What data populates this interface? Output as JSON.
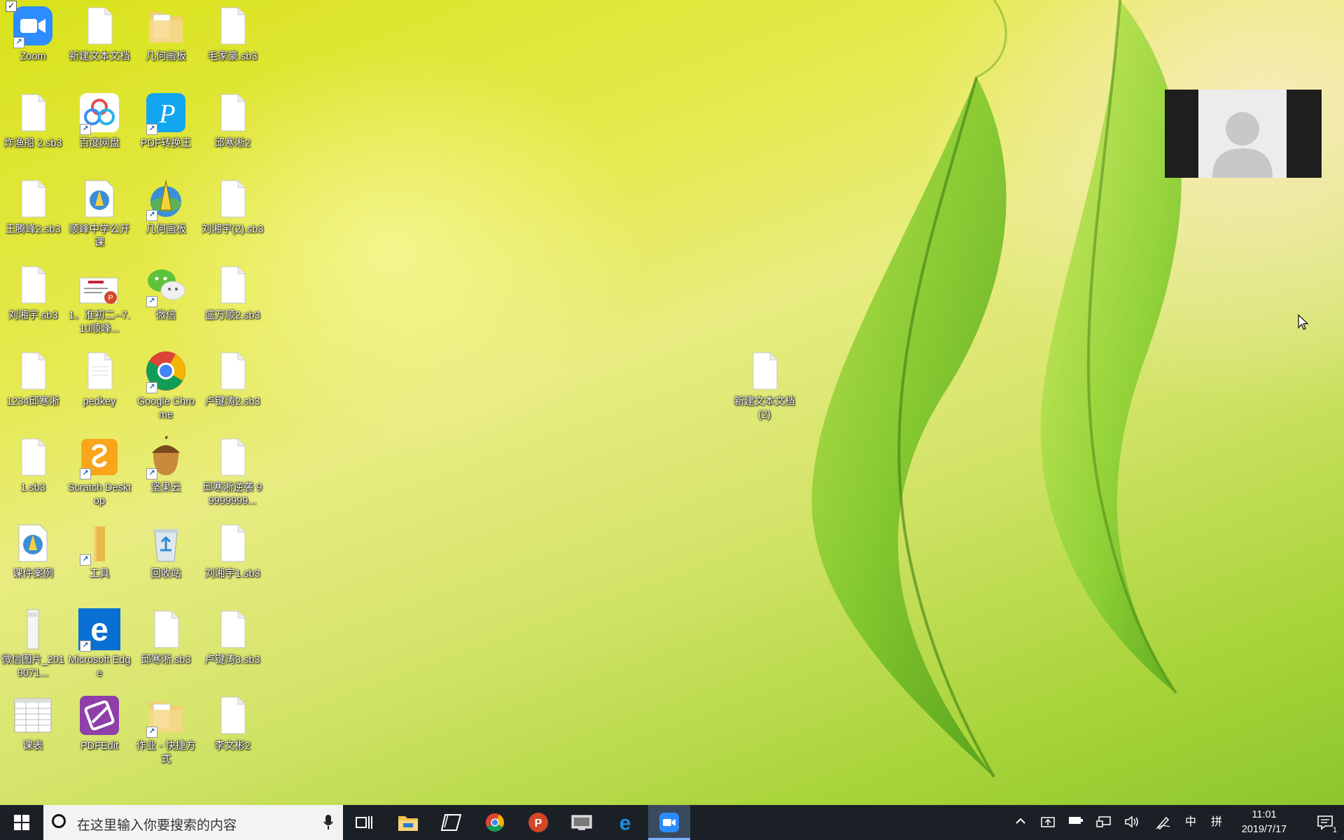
{
  "desktop": {
    "icons": [
      {
        "label": "Zoom",
        "icon": "zoom-icon"
      },
      {
        "label": "新建文本文档",
        "icon": "text-file-icon"
      },
      {
        "label": "几何画板",
        "icon": "folder-icon"
      },
      {
        "label": "毛家豪.sb3",
        "icon": "blank-file-icon"
      },
      {
        "label": "炸渔船 2.sb3",
        "icon": "blank-file-icon"
      },
      {
        "label": "百度网盘",
        "icon": "baidu-netdisk-icon"
      },
      {
        "label": "PDF转换王",
        "icon": "pdf-converter-icon"
      },
      {
        "label": "邱寒淅2",
        "icon": "blank-file-icon"
      },
      {
        "label": "王腾峰2.sb3",
        "icon": "blank-file-icon"
      },
      {
        "label": "顺峰中学公开课",
        "icon": "geometry-file-icon"
      },
      {
        "label": "几何画板",
        "icon": "geometry-sketchpad-icon"
      },
      {
        "label": "刘湘宇(2).sb3",
        "icon": "blank-file-icon"
      },
      {
        "label": "刘湘宇.sb3",
        "icon": "blank-file-icon"
      },
      {
        "label": "1、准初二--7.10顺峰...",
        "icon": "powerpoint-file-icon"
      },
      {
        "label": "微信",
        "icon": "wechat-icon"
      },
      {
        "label": "盛万顺2.sb3",
        "icon": "blank-file-icon"
      },
      {
        "label": "1234邱寒淅",
        "icon": "blank-file-icon"
      },
      {
        "label": "pedkey",
        "icon": "text-file-icon"
      },
      {
        "label": "Google Chrome",
        "icon": "chrome-icon"
      },
      {
        "label": "卢键涛2.sb3",
        "icon": "blank-file-icon"
      },
      {
        "label": "1.sb3",
        "icon": "blank-file-icon"
      },
      {
        "label": "Scratch Desktop",
        "icon": "scratch-icon"
      },
      {
        "label": "坚果云",
        "icon": "nutstore-icon"
      },
      {
        "label": "邱寒淅逆袭 99999999...",
        "icon": "blank-file-icon"
      },
      {
        "label": "课件案例",
        "icon": "geometry-file-icon"
      },
      {
        "label": "工具",
        "icon": "folder-shortcut-icon"
      },
      {
        "label": "回收站",
        "icon": "recycle-bin-icon"
      },
      {
        "label": "刘湘宇1.sb3",
        "icon": "blank-file-icon"
      },
      {
        "label": "微信图片_2019071...",
        "icon": "image-file-icon"
      },
      {
        "label": "Microsoft Edge",
        "icon": "edge-icon"
      },
      {
        "label": "邱寒淅.sb3",
        "icon": "blank-file-icon"
      },
      {
        "label": "卢键涛3.sb3",
        "icon": "blank-file-icon"
      },
      {
        "label": "课表",
        "icon": "spreadsheet-file-icon"
      },
      {
        "label": "PDFEdit",
        "icon": "pdfedit-icon"
      },
      {
        "label": "作业 - 快捷方式",
        "icon": "folder-shortcut-icon"
      },
      {
        "label": "李文彬2",
        "icon": "blank-file-icon"
      },
      {
        "label": "新建文本文档 (2)",
        "icon": "text-file-icon"
      }
    ]
  },
  "video_tile": {
    "icon": "participant-avatar-icon"
  },
  "taskbar": {
    "search_placeholder": "在这里输入你要搜索的内容",
    "apps": [
      "task-view-icon",
      "file-explorer-icon",
      "sticky-notes-icon",
      "chrome-icon",
      "powerpoint-icon",
      "screen-app-icon",
      "edge-icon",
      "zoom-icon"
    ],
    "active_app": "zoom-icon",
    "tray": {
      "ime_mode": "中",
      "ime_layout": "拼",
      "time": "11:01",
      "date": "2019/7/17",
      "notifications_count": "1"
    }
  },
  "colors": {
    "taskbar": "#1b2026",
    "active_indicator": "#7db0ff",
    "zoom_blue": "#2d8cff"
  }
}
